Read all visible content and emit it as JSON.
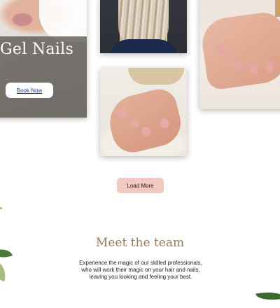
{
  "gallery": {
    "gel_card": {
      "title": "Gel Nails",
      "cta_label": "Book Now"
    }
  },
  "load_more_label": "Load More",
  "team": {
    "heading": "Meet the team",
    "description_lines": [
      "Experience the magic of our skilled professionals,",
      "who will work their magic on your hair and nails,",
      "leaving you looking and feeling your best."
    ]
  },
  "colors": {
    "heading_gold": "#9b7a56",
    "load_more_bg": "#f3c9bf",
    "overlay": "#58544f",
    "link_blue": "#1f3a7a"
  }
}
